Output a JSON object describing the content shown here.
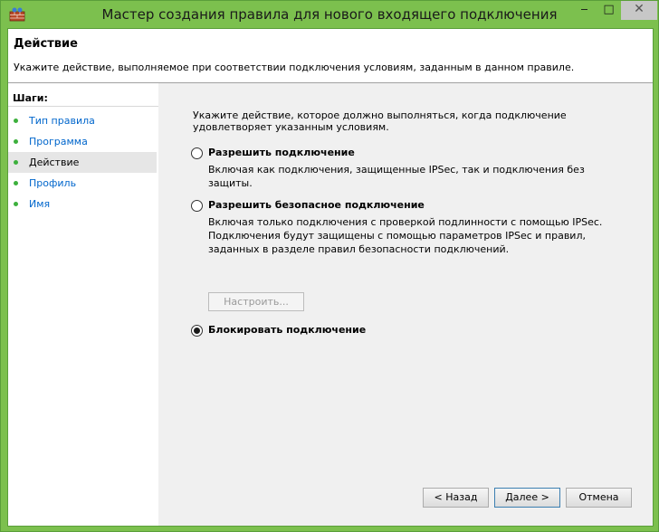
{
  "window": {
    "title": "Мастер создания правила для нового входящего подключения",
    "minimize": "‒",
    "maximize": "□",
    "close": "✕"
  },
  "header": {
    "title": "Действие",
    "description": "Укажите действие, выполняемое при соответствии подключения условиям, заданным в данном правиле."
  },
  "sidebar": {
    "title": "Шаги:",
    "steps": [
      {
        "label": "Тип правила"
      },
      {
        "label": "Программа"
      },
      {
        "label": "Действие",
        "active": true
      },
      {
        "label": "Профиль"
      },
      {
        "label": "Имя"
      }
    ]
  },
  "content": {
    "intro": "Укажите действие, которое должно выполняться, когда подключение удовлетворяет указанным условиям.",
    "options": [
      {
        "label": "Разрешить подключение",
        "desc": "Включая как подключения, защищенные IPSec, так и подключения без защиты.",
        "checked": false
      },
      {
        "label": "Разрешить безопасное подключение",
        "desc": "Включая только подключения с проверкой подлинности с помощью IPSec. Подключения будут защищены с помощью параметров IPSec и правил, заданных в разделе правил безопасности подключений.",
        "checked": false
      },
      {
        "label": "Блокировать подключение",
        "desc": "",
        "checked": true
      }
    ],
    "settings_button": "Настроить..."
  },
  "buttons": {
    "back": "< Назад",
    "next": "Далее >",
    "cancel": "Отмена"
  },
  "colors": {
    "titlebar": "#7cc04e",
    "link": "#0066cc",
    "step_dot": "#3cb03c"
  }
}
